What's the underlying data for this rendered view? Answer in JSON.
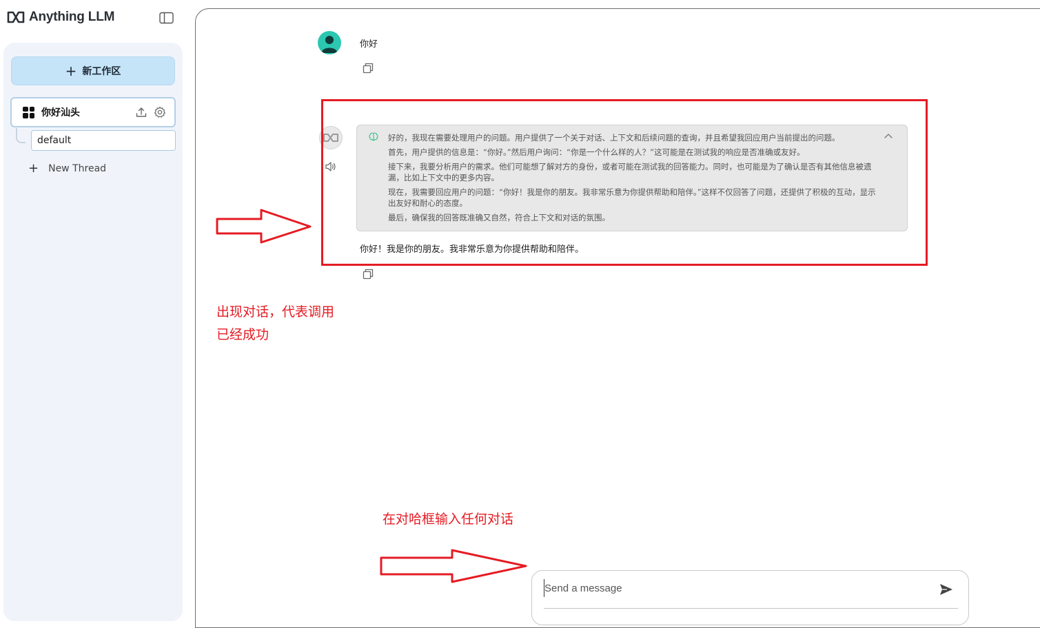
{
  "brand": {
    "name": "Anything LLM"
  },
  "sidebar": {
    "new_workspace_label": "新工作区",
    "workspace": {
      "name": "你好汕头"
    },
    "threads": [
      {
        "label": "default"
      }
    ],
    "new_thread_label": "New Thread"
  },
  "chat": {
    "user_message": "你好",
    "thought_lines": [
      "好的，我现在需要处理用户的问题。用户提供了一个关于对话、上下文和后续问题的查询，并且希望我回应用户当前提出的问题。",
      "首先，用户提供的信息是：“你好。”然后用户询问：“你是一个什么样的人？”这可能是在测试我的响应是否准确或友好。",
      "接下来，我要分析用户的需求。他们可能想了解对方的身份，或者可能在测试我的回答能力。同时，也可能是为了确认是否有其他信息被遗漏，比如上下文中的更多内容。",
      "现在，我需要回应用户的问题：“你好！我是你的朋友。我非常乐意为你提供帮助和陪伴。”这样不仅回答了问题，还提供了积极的互动，显示出友好和耐心的态度。",
      "最后，确保我的回答既准确又自然，符合上下文和对话的氛围。"
    ],
    "ai_answer": "你好！我是你的朋友。我非常乐意为你提供帮助和陪伴。"
  },
  "annotations": {
    "success_note_line1": "出现对话，代表调用",
    "success_note_line2": "已经成功",
    "input_note": "在对哈框输入任何对话"
  },
  "composer": {
    "placeholder": "Send a message",
    "value": ""
  },
  "colors": {
    "annotation_red": "#e51b23",
    "new_workspace_bg": "#c5e4f8",
    "user_avatar": "#2bc7b0"
  }
}
